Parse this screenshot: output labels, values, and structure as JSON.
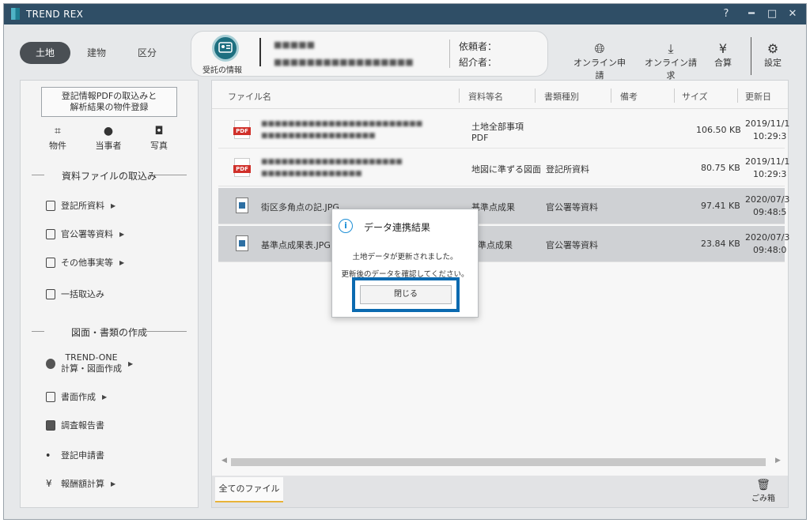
{
  "app": {
    "title": "TREND REX"
  },
  "window_controls": {
    "help": "?",
    "minimize": "━",
    "maximize": "□",
    "close": "✕"
  },
  "header": {
    "segments": [
      "土地",
      "建物",
      "区分"
    ],
    "active_segment": "土地",
    "card_label": "受託の情報",
    "client_label": "依頼者：",
    "referrer_label": "紹介者：",
    "tools": [
      {
        "label": "オンライン申請",
        "icon": "globe-icon"
      },
      {
        "label": "オンライン請求",
        "icon": "download-icon"
      },
      {
        "label": "合算",
        "icon": "yen-icon"
      },
      {
        "label": "設定",
        "icon": "gear-icon"
      }
    ]
  },
  "sidebar": {
    "import_button": [
      "登記情報PDFの取込みと",
      "解析結果の物件登録"
    ],
    "quick_items": [
      {
        "label": "物件",
        "icon": "property-icon"
      },
      {
        "label": "当事者",
        "icon": "person-icon"
      },
      {
        "label": "写真",
        "icon": "camera-icon"
      }
    ],
    "section1_title": "資料ファイルの取込み",
    "section1_items": [
      "登記所資料",
      "官公署等資料",
      "その他事実等",
      "一括取込み"
    ],
    "section2_title": "図面・書類の作成",
    "section2_items": [
      "TREND-ONE",
      "計算・図面作成",
      "書面作成",
      "調査報告書",
      "登記申請書",
      "報酬額計算"
    ]
  },
  "table": {
    "columns": [
      "ファイル名",
      "資料等名",
      "書類種別",
      "備考",
      "サイズ",
      "更新日"
    ],
    "rows": [
      {
        "file": "",
        "doc_name": "土地全部事項",
        "doc_name2": "PDF",
        "type": "",
        "size": "106.50 KB",
        "date": "2019/11/1",
        "time": "10:29:3",
        "kind": "pdf"
      },
      {
        "file": "",
        "doc_name": "地図に準ずる図面",
        "doc_name2": "",
        "type": "登記所資料",
        "size": "80.75 KB",
        "date": "2019/11/1",
        "time": "10:29:3",
        "kind": "pdf"
      },
      {
        "file": "街区多角点の記.JPG",
        "doc_name": "基準点成果",
        "doc_name2": "",
        "type": "官公署等資料",
        "size": "97.41 KB",
        "date": "2020/07/3",
        "time": "09:48:5",
        "kind": "jpg"
      },
      {
        "file": "基準点成果表.JPG",
        "doc_name": "準点成果",
        "doc_name2": "",
        "type": "官公署等資料",
        "size": "23.84 KB",
        "date": "2020/07/3",
        "time": "09:48:0",
        "kind": "jpg"
      }
    ]
  },
  "bottom": {
    "tab_all": "全てのファイル",
    "trash": "ごみ箱"
  },
  "dialog": {
    "title": "データ連携結果",
    "message1": "土地データが更新されました。",
    "message2": "更新後のデータを確認してください。",
    "close_button": "閉じる"
  },
  "colors": {
    "titlebar": "#2f4e66",
    "highlight": "#0b6ab0",
    "accent_tab": "#e8b339"
  }
}
